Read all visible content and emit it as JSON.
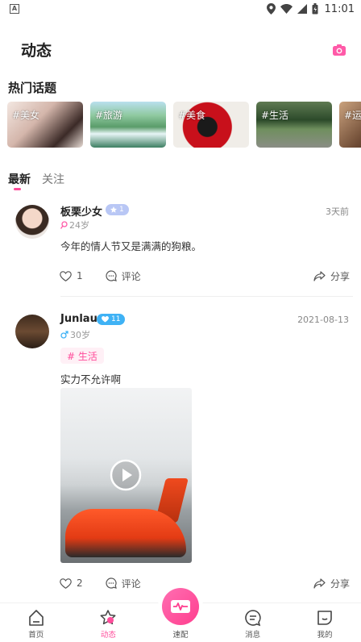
{
  "status_bar": {
    "time": "11:01",
    "left_icon_letter": "A",
    "battery_glyph": ""
  },
  "header": {
    "title": "动态",
    "camera_icon": "camera-icon"
  },
  "hot_topics": {
    "title": "热门话题",
    "items": [
      {
        "label": "#美女"
      },
      {
        "label": "#旅游"
      },
      {
        "label": "#美食"
      },
      {
        "label": "#生活"
      },
      {
        "label": "#运动"
      }
    ]
  },
  "tabs": [
    {
      "label": "最新",
      "active": true
    },
    {
      "label": "关注",
      "active": false
    }
  ],
  "posts": [
    {
      "username": "板栗少女",
      "level": "1",
      "age": "24岁",
      "gender": "female",
      "date": "3天前",
      "text": "今年的情人节又是满满的狗粮。",
      "tag": "",
      "likes": "1",
      "comment_label": "评论",
      "share_label": "分享"
    },
    {
      "username": "Junlau",
      "level": "11",
      "age": "30岁",
      "gender": "male",
      "date": "2021-08-13",
      "tag": "# 生活",
      "text": "实力不允许啊",
      "likes": "2",
      "comment_label": "评论",
      "share_label": "分享"
    }
  ],
  "bottom_nav": {
    "items": [
      {
        "label": "首页",
        "icon": "home-icon"
      },
      {
        "label": "动态",
        "icon": "star-icon",
        "active": true
      },
      {
        "label": "速配",
        "icon": "match-icon"
      },
      {
        "label": "消息",
        "icon": "message-icon"
      },
      {
        "label": "我的",
        "icon": "profile-icon"
      }
    ]
  },
  "colors": {
    "accent": "#ff4d9b",
    "level_female": "#b9c7f5",
    "level_male": "#3fb2f5"
  }
}
